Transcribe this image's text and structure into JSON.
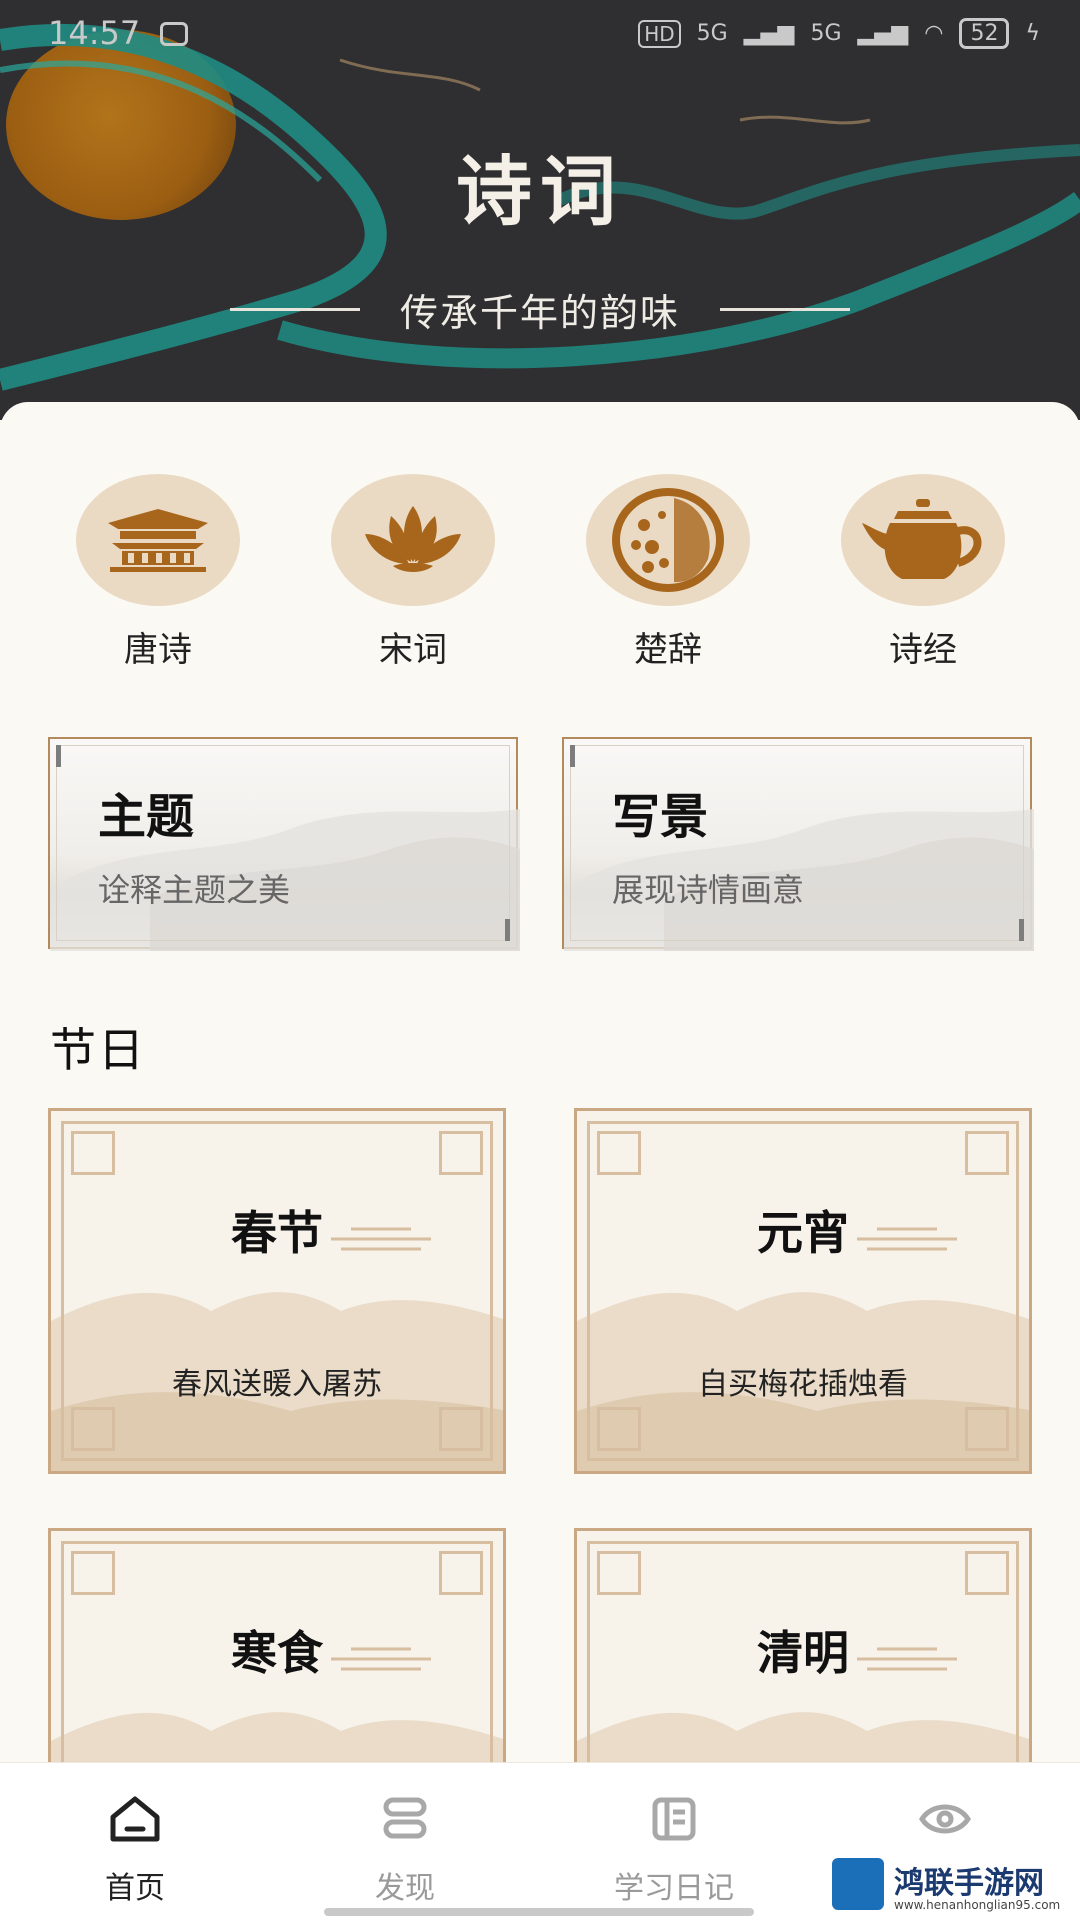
{
  "status_bar": {
    "time": "14:57",
    "network_1": "5G",
    "network_2": "5G",
    "battery": "52"
  },
  "header": {
    "title": "诗词",
    "subtitle": "传承千年的韵味"
  },
  "categories": [
    {
      "label": "唐诗",
      "icon": "palace-icon"
    },
    {
      "label": "宋词",
      "icon": "lotus-icon"
    },
    {
      "label": "楚辞",
      "icon": "mooncake-icon"
    },
    {
      "label": "诗经",
      "icon": "teapot-icon"
    }
  ],
  "feature_cards": [
    {
      "title": "主题",
      "desc": "诠释主题之美"
    },
    {
      "title": "写景",
      "desc": "展现诗情画意"
    }
  ],
  "festival_section": {
    "title": "节日",
    "items": [
      {
        "name": "春节",
        "verse": "春风送暖入屠苏"
      },
      {
        "name": "元宵",
        "verse": "自买梅花插烛看"
      },
      {
        "name": "寒食",
        "verse": ""
      },
      {
        "name": "清明",
        "verse": ""
      }
    ]
  },
  "bottom_nav": [
    {
      "label": "首页",
      "icon": "home-icon",
      "active": true
    },
    {
      "label": "发现",
      "icon": "discover-icon",
      "active": false
    },
    {
      "label": "学习日记",
      "icon": "diary-icon",
      "active": false
    },
    {
      "label": "",
      "icon": "eye-icon",
      "active": false
    }
  ],
  "watermark": {
    "name": "鸿联手游网",
    "url": "www.henanhonglian95.com"
  },
  "colors": {
    "accent": "#b28a5c",
    "icon_bg": "#eadac3",
    "icon_fg": "#a8661d",
    "teal": "#1f8c83"
  }
}
